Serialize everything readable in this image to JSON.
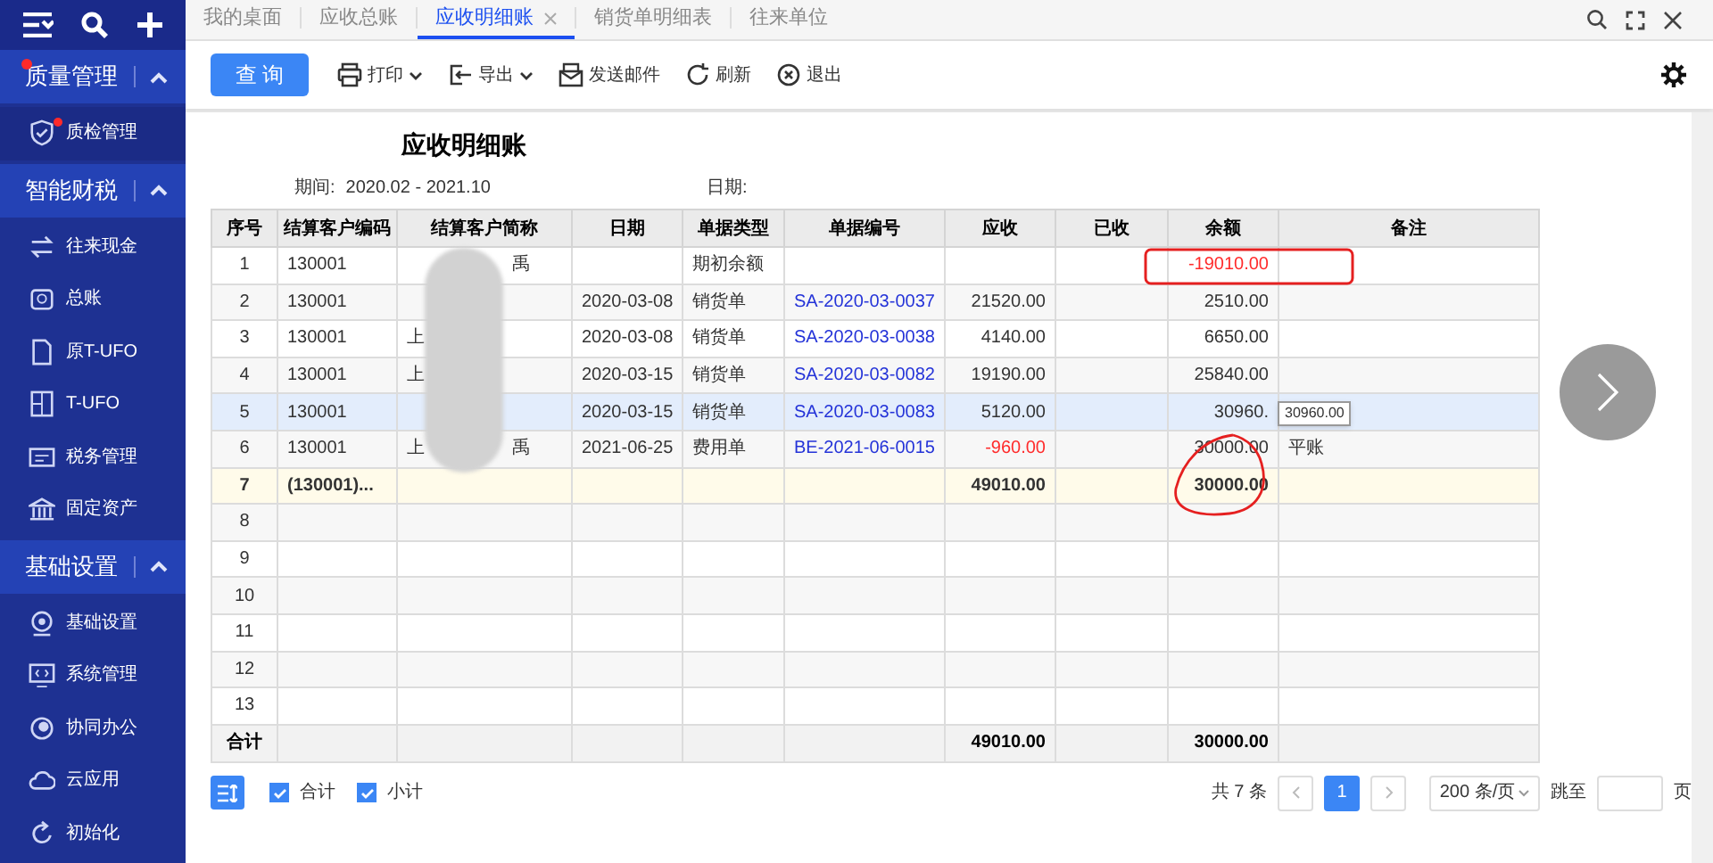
{
  "tabs": [
    {
      "label": "我的桌面",
      "selected": false
    },
    {
      "label": "应收总账",
      "selected": false
    },
    {
      "label": "应收明细账",
      "selected": true,
      "closable": true
    },
    {
      "label": "销货单明细表",
      "selected": false
    },
    {
      "label": "往来单位",
      "selected": false
    }
  ],
  "sidebar": [
    {
      "label": "质量管理",
      "expanded": true,
      "dot": true,
      "items": [
        {
          "label": "质检管理",
          "dot": true,
          "selected": true
        }
      ]
    },
    {
      "label": "智能财税",
      "expanded": true,
      "items": [
        {
          "label": "往来现金",
          "selected": false
        },
        {
          "label": "总账",
          "selected": false
        },
        {
          "label": "原T-UFO",
          "selected": false
        },
        {
          "label": "T-UFO",
          "selected": false
        },
        {
          "label": "税务管理",
          "selected": false
        },
        {
          "label": "固定资产",
          "selected": false
        }
      ]
    },
    {
      "label": "基础设置",
      "expanded": true,
      "items": [
        {
          "label": "基础设置",
          "selected": false
        },
        {
          "label": "系统管理",
          "selected": false
        },
        {
          "label": "协同办公",
          "selected": false
        },
        {
          "label": "云应用",
          "selected": false
        },
        {
          "label": "初始化",
          "selected": false
        }
      ]
    }
  ],
  "toolbar": {
    "primary": "查 询",
    "actions": [
      {
        "label": "打印",
        "menu": true
      },
      {
        "label": "导出",
        "menu": true
      },
      {
        "label": "发送邮件"
      },
      {
        "label": "刷新"
      },
      {
        "label": "退出"
      }
    ]
  },
  "report": {
    "title": "应收明细账",
    "period_label": "期间:",
    "period": "2020.02 - 2021.10",
    "date_label": "日期:"
  },
  "table": {
    "columns": [
      "序号",
      "结算客户编码",
      "结算客户简称",
      "日期",
      "单据类型",
      "单据编号",
      "应收",
      "已收",
      "余额",
      "备注"
    ],
    "rows": [
      {
        "no": "1",
        "code": "130001",
        "name_right": "禹",
        "type": "期初余额",
        "balance": "-19010.00",
        "negative_balance": true,
        "kind": "detail",
        "selected": false
      },
      {
        "no": "2",
        "code": "130001",
        "date": "2020-03-08",
        "type": "销货单",
        "doc": "SA-2020-03-0037",
        "receivable": "21520.00",
        "balance": "2510.00",
        "kind": "detail",
        "selected": false
      },
      {
        "no": "3",
        "code": "130001",
        "name_left": "上",
        "date": "2020-03-08",
        "type": "销货单",
        "doc": "SA-2020-03-0038",
        "receivable": "4140.00",
        "balance": "6650.00",
        "kind": "detail",
        "selected": false
      },
      {
        "no": "4",
        "code": "130001",
        "name_left": "上",
        "date": "2020-03-15",
        "type": "销货单",
        "doc": "SA-2020-03-0082",
        "receivable": "19190.00",
        "balance": "25840.00",
        "kind": "detail",
        "selected": false
      },
      {
        "no": "5",
        "code": "130001",
        "date": "2020-03-15",
        "type": "销货单",
        "doc": "SA-2020-03-0083",
        "receivable": "5120.00",
        "balance": "30960.",
        "kind": "detail",
        "selected": true
      },
      {
        "no": "6",
        "code": "130001",
        "name_left": "上",
        "name_right": "禹",
        "date": "2021-06-25",
        "type": "费用单",
        "doc": "BE-2021-06-0015",
        "receivable": "-960.00",
        "balance": "30000.00",
        "note": "平账",
        "negative_receivable": true,
        "kind": "detail",
        "selected": false
      },
      {
        "no": "7",
        "code": "(130001)...",
        "receivable": "49010.00",
        "balance": "30000.00",
        "kind": "subtotal",
        "selected": false
      },
      {
        "no": "8",
        "kind": "empty",
        "selected": false
      },
      {
        "no": "9",
        "kind": "empty",
        "selected": false
      },
      {
        "no": "10",
        "kind": "empty",
        "selected": false
      },
      {
        "no": "11",
        "kind": "empty",
        "selected": false
      },
      {
        "no": "12",
        "kind": "empty",
        "selected": false
      },
      {
        "no": "13",
        "kind": "empty",
        "selected": false
      }
    ],
    "total": {
      "label": "合计",
      "receivable": "49010.00",
      "balance": "30000.00"
    },
    "tooltip": "30960.00"
  },
  "footer": {
    "options": [
      {
        "label": "合计",
        "checked": true
      },
      {
        "label": "小计",
        "checked": true
      }
    ],
    "count": "共 7 条",
    "pages": [
      {
        "label": "1",
        "selected": true
      }
    ],
    "page_size": "200 条/页",
    "jump_label": "跳至",
    "page_unit": "页"
  }
}
